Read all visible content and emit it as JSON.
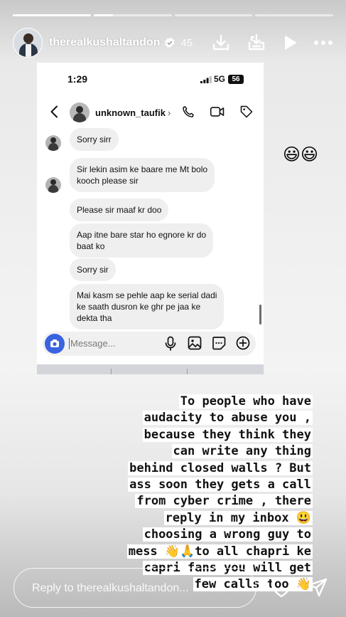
{
  "story": {
    "progress": [
      1.0,
      0.25,
      0,
      0
    ],
    "username": "therealkushaltandon",
    "time": "45",
    "actions": [
      "download-icon",
      "add-to-story-icon",
      "play-icon",
      "more-icon"
    ]
  },
  "screenshot": {
    "status_time": "1:29",
    "network": "5G",
    "battery": "56",
    "contact_name": "unknown_taufik",
    "header_icons": [
      "back-icon",
      "phone-icon",
      "video-icon",
      "tag-icon"
    ],
    "messages": [
      {
        "lines": [
          "Sorry sirr"
        ],
        "avatar": true
      },
      {
        "lines": [
          "Sir lekin asim ke baare me Mt bolo",
          "kooch please sir"
        ],
        "avatar": true
      },
      {
        "lines": [
          "Please sir maaf kr doo"
        ],
        "avatar": false
      },
      {
        "lines": [
          "Aap itne bare star ho egnore kr do",
          "baat ko"
        ],
        "avatar": false
      },
      {
        "lines": [
          "Sorry sir"
        ],
        "avatar": false
      },
      {
        "lines": [
          "Mai kasm se pehle aap ke serial dadi",
          "ke saath dusron ke ghr pe jaa ke",
          "dekta tha"
        ],
        "avatar": false
      }
    ],
    "composer_placeholder": "Message..."
  },
  "side_emoji": "😃😃",
  "caption_lines": [
    "To people  who have",
    "audacity to abuse you ,",
    "because they think they",
    "can write any thing",
    "behind closed walls ? But",
    "ass soon they gets a call",
    "from cyber crime , there",
    "reply in my inbox 😃",
    "choosing a wrong guy to",
    "mess 👋🙏to all chapri ke",
    "capri fans you will get",
    "few calls too 👋"
  ],
  "reply": {
    "placeholder": "Reply to therealkushaltandon..."
  },
  "colors": {
    "accent": "#3a63e0",
    "bubble": "#efefef"
  }
}
